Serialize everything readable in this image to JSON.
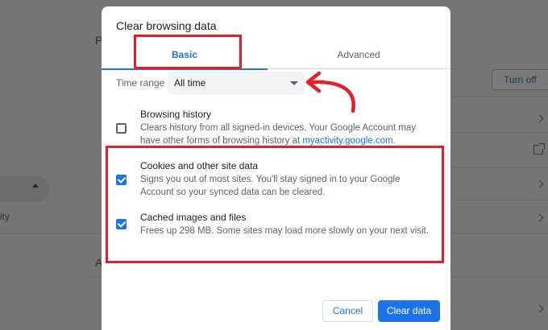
{
  "background": {
    "letters": [
      "P",
      "A"
    ],
    "partial_text": "ity",
    "turn_off_label": "Turn off"
  },
  "dialog": {
    "title": "Clear browsing data",
    "tabs": [
      {
        "label": "Basic",
        "selected": true
      },
      {
        "label": "Advanced",
        "selected": false
      }
    ],
    "time_range": {
      "label": "Time range",
      "value": "All time"
    },
    "options": [
      {
        "title": "Browsing history",
        "desc_pre": "Clears history from all signed-in devices. Your Google Account may have other forms of browsing history at ",
        "desc_link": "myactivity.google.com",
        "desc_post": ".",
        "checked": false
      },
      {
        "title": "Cookies and other site data",
        "desc": "Signs you out of most sites. You'll stay signed in to your Google Account so your synced data can be cleared.",
        "checked": true
      },
      {
        "title": "Cached images and files",
        "desc": "Frees up 298 MB. Some sites may load more slowly on your next visit.",
        "checked": true
      }
    ],
    "buttons": {
      "cancel": "Cancel",
      "clear": "Clear data"
    }
  },
  "colors": {
    "accent": "#1a73e8",
    "annotation": "#e2202c",
    "overlay": "#757575"
  }
}
